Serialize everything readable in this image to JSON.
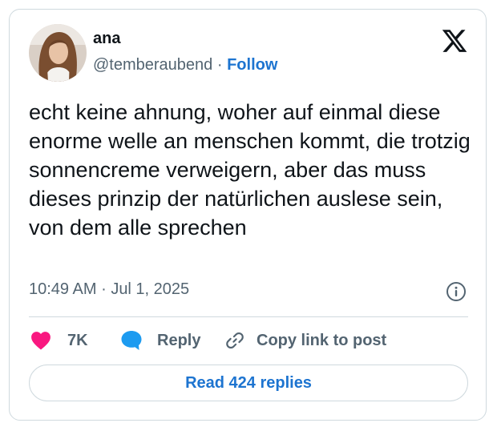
{
  "author": {
    "name": "ana",
    "handle": "@temberaubend",
    "separator": "·",
    "follow_label": "Follow"
  },
  "tweet": {
    "text": "echt keine ahnung, woher auf einmal diese enorme welle an menschen kommt, die trotzig sonnencreme verweigern, aber das muss dieses prinzip der natürlichen auslese sein, von dem alle sprechen",
    "time": "10:49 AM",
    "meta_separator": "·",
    "date": "Jul 1, 2025"
  },
  "actions": {
    "like_count": "7K",
    "reply_label": "Reply",
    "copy_label": "Copy link to post"
  },
  "footer": {
    "read_replies_label": "Read 424 replies"
  },
  "icons": {
    "logo": "x-logo-icon",
    "info": "info-icon",
    "like": "heart-icon",
    "reply": "speech-bubble-icon",
    "copy": "link-icon"
  },
  "colors": {
    "heart": "#f91880",
    "reply": "#1d9bf0",
    "link_text": "#1d74d0",
    "secondary_text": "#536471",
    "border": "#cfd9de"
  }
}
